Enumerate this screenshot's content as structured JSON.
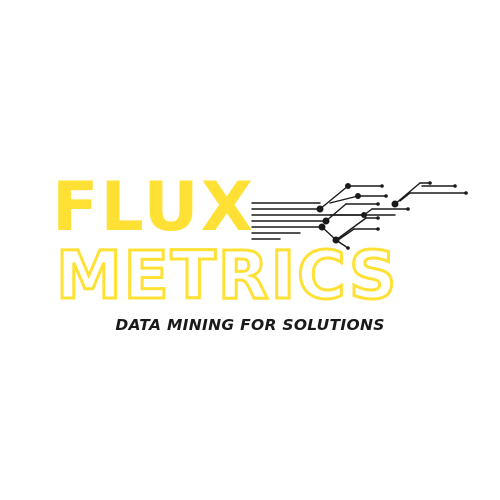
{
  "logo": {
    "word1": "FLUX",
    "word2": "METRICS",
    "tagline": "DATA MINING FOR SOLUTIONS",
    "colors": {
      "accent": "#FFE135",
      "text": "#1a1a1a",
      "background": "#ffffff"
    },
    "icon": "circuit-lines-icon"
  }
}
